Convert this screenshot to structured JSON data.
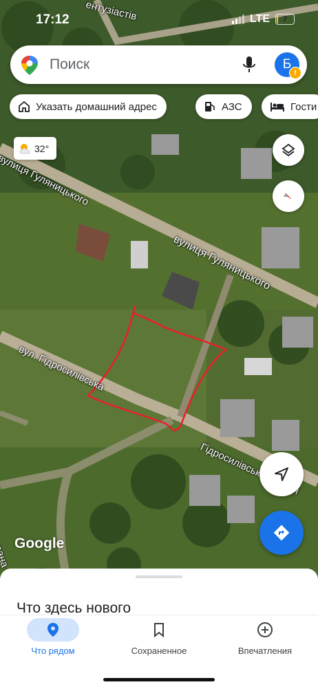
{
  "status_bar": {
    "time": "17:12",
    "network": "LTE",
    "battery": "7"
  },
  "search": {
    "placeholder": "Поиск",
    "avatar_letter": "Б",
    "icons": [
      "maps-pin-icon",
      "mic-icon",
      "warning-badge-icon"
    ]
  },
  "chips": [
    {
      "label": "Указать домашний адрес",
      "icon": "home-icon"
    },
    {
      "label": "АЗС",
      "icon": "gas-station-icon"
    },
    {
      "label": "Гости",
      "icon": "hotel-bed-icon"
    }
  ],
  "weather": {
    "temp": "32°",
    "icon": "partly-cloudy-icon"
  },
  "map": {
    "road_labels": [
      "ентузіастів",
      "вулиця Гуляницького",
      "вулиця Гуляницького",
      "вул. Гідросилівська",
      "Гідросилівська вулиця",
      "рана"
    ],
    "attribution": "Google",
    "colors": {
      "annotation": "#e8202a",
      "accent": "#1a73e8"
    }
  },
  "map_controls": [
    "layers-icon",
    "compass-icon",
    "my-location-icon",
    "directions-icon"
  ],
  "sheet": {
    "title": "Что здесь нового"
  },
  "bottom_nav": [
    {
      "label": "Что рядом",
      "icon": "explore-pin-icon",
      "active": true
    },
    {
      "label": "Сохраненное",
      "icon": "bookmark-icon",
      "active": false
    },
    {
      "label": "Впечатления",
      "icon": "add-circle-icon",
      "active": false
    }
  ]
}
